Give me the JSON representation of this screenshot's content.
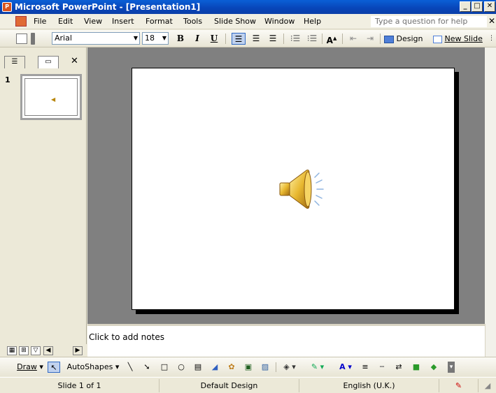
{
  "window": {
    "title": "Microsoft PowerPoint - [Presentation1]",
    "app_icon_text": "P",
    "minimize_glyph": "_",
    "maximize_glyph": "□",
    "close_glyph": "✕"
  },
  "menu": {
    "items": [
      "File",
      "Edit",
      "View",
      "Insert",
      "Format",
      "Tools",
      "Slide Show",
      "Window",
      "Help"
    ],
    "help_placeholder": "Type a question for help",
    "close_glyph": "✕"
  },
  "toolbar": {
    "font_name": "Arial",
    "font_size": "18",
    "bold": "B",
    "italic": "I",
    "underline": "U",
    "increase_font": "A",
    "design_label": "Design",
    "new_slide_label": "New Slide"
  },
  "left_pane": {
    "close_glyph": "✕",
    "slide_number": "1"
  },
  "notes": {
    "placeholder": "Click to add notes"
  },
  "draw_toolbar": {
    "draw_label": "Draw",
    "autoshapes_label": "AutoShapes"
  },
  "status": {
    "slide_info": "Slide 1 of 1",
    "design_name": "Default Design",
    "language": "English (U.K.)"
  },
  "colors": {
    "title_bar": "#0a5fd6",
    "slide_background": "#ffffff",
    "workspace": "#808080"
  },
  "icons": [
    "speaker-icon",
    "new-document-icon",
    "design-icon",
    "new-slide-icon",
    "select-arrow-icon",
    "line-icon",
    "arrow-icon",
    "rectangle-icon",
    "oval-icon",
    "textbox-icon",
    "wordart-icon",
    "diagram-icon",
    "clipart-icon",
    "picture-icon",
    "fill-color-icon",
    "line-color-icon",
    "font-color-icon"
  ]
}
